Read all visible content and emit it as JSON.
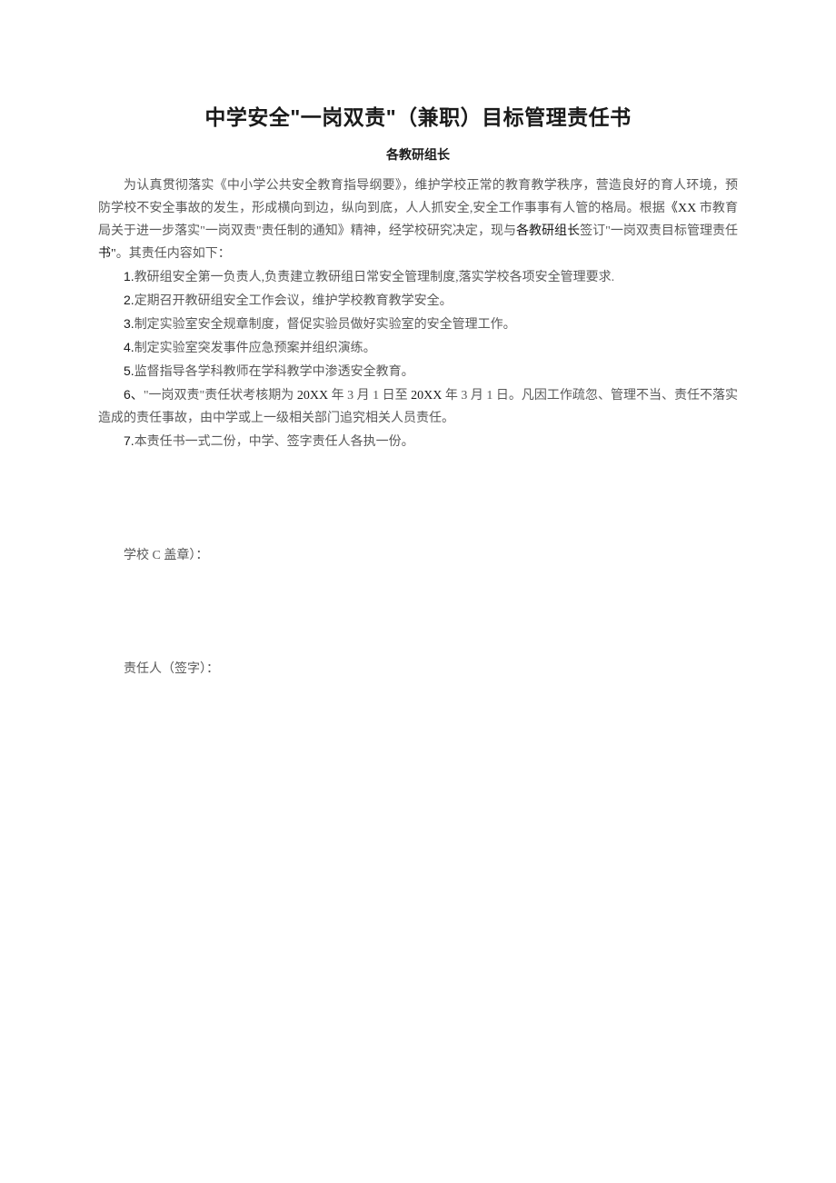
{
  "title": "中学安全\"一岗双责\"（兼职）目标管理责任书",
  "subtitle": "各教研组长",
  "intro_part1": "为认真贯彻落实《中小学公共安全教育指导纲要》，维护学校正常的教育教学秩序，营造良好的育人环境，预防学校不安全事故的发生，形成横向到边，纵向到底，人人抓安全,安全工作事事有人管的格局。根据",
  "intro_emph1": "《XX",
  "intro_part2": " 市教育局关于进一步落实\"一岗双责\"责任制的通知》精神，经学校研究决定，现与",
  "intro_emph2": "各教研组长",
  "intro_part3": "签订\"一岗双责目标管理责任",
  "intro_emph3": "书\"",
  "intro_part4": "。其责任内容如下：",
  "items": [
    {
      "n": "1.",
      "t": "教研组安全第一负责人,负责建立教研组日常安全管理制度,落实学校各项安全管理要求."
    },
    {
      "n": "2.",
      "t": "定期召开教研组安全工作会议，维护学校教育教学安全。"
    },
    {
      "n": "3.",
      "t": "制定实验室安全规章制度，督促实验员做好实验室的安全管理工作。"
    },
    {
      "n": "4.",
      "t": "制定实验室突发事件应急预案并组织演练。"
    },
    {
      "n": "5.",
      "t": "监督指导各学科教师在学科教学中渗透安全教育。"
    }
  ],
  "item6_n": "6、",
  "item6_t1": "\"一岗双责\"责任状考核期为 ",
  "item6_d1": "20XX",
  "item6_t2": " 年 3 月 1 日至 ",
  "item6_d2": "20XX",
  "item6_t3": " 年 3 月 1 日。凡因工作疏忽、管理不当、责任不落实造成的责任事故，由中学或上一级相关部门追究相关人员责任。",
  "item7_n": "7.",
  "item7_t": "本责任书一式二份，中学、签字责任人各执一份。",
  "sig1": "学校 C 盖章）：",
  "sig2": "责任人（签字）："
}
